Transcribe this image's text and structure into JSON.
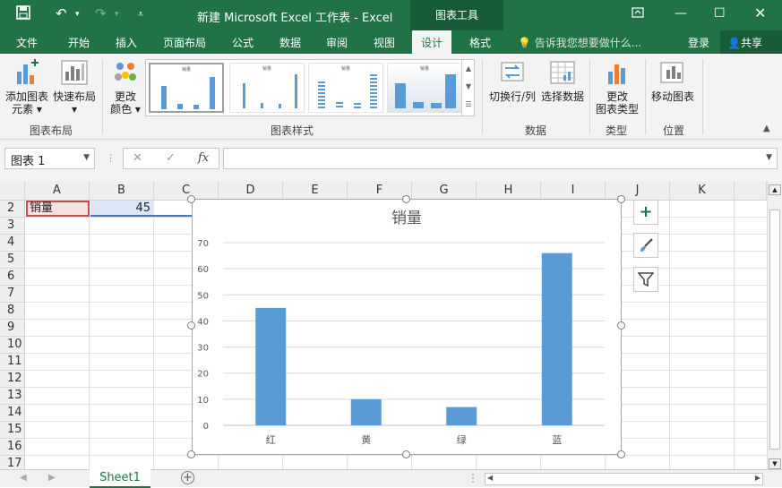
{
  "titlebar": {
    "save_icon": "save-icon",
    "undo_icon": "undo-icon",
    "redo_icon": "redo-icon",
    "customize_icon": "customize-icon",
    "title": "新建 Microsoft Excel 工作表 - Excel",
    "context_tab": "图表工具",
    "colors": {
      "brand": "#217346",
      "dark": "#185c37"
    }
  },
  "tabs": {
    "items": [
      "文件",
      "开始",
      "插入",
      "页面布局",
      "公式",
      "数据",
      "审阅",
      "视图",
      "设计",
      "格式"
    ],
    "active": "设计",
    "tell_me": "告诉我您想要做什么...",
    "login": "登录",
    "share": "共享"
  },
  "ribbon": {
    "add_element": "添加图表",
    "add_element_2": "元素",
    "quick_layout": "快速布局",
    "change_colors": "更改",
    "change_colors_2": "颜色",
    "group_layout": "图表布局",
    "group_styles": "图表样式",
    "switch_row_col": "切换行/列",
    "select_data": "选择数据",
    "group_data": "数据",
    "change_type": "更改",
    "change_type_2": "图表类型",
    "group_type": "类型",
    "move_chart": "移动图表",
    "group_location": "位置",
    "style_thumb_titles": [
      "销量",
      "销量",
      "销量",
      "销量"
    ]
  },
  "formula": {
    "name_box": "图表 1",
    "fx": "fx",
    "value": ""
  },
  "grid": {
    "columns": [
      "A",
      "B",
      "C",
      "D",
      "E",
      "F",
      "G",
      "H",
      "I",
      "J",
      "K"
    ],
    "rows": [
      "2",
      "3",
      "4",
      "5",
      "6",
      "7",
      "8",
      "9",
      "10",
      "11",
      "12",
      "13",
      "14",
      "15",
      "16",
      "17"
    ],
    "a2": "销量",
    "b2": "45"
  },
  "chart_data": {
    "type": "bar",
    "title": "销量",
    "categories": [
      "红",
      "黄",
      "绿",
      "蓝"
    ],
    "values": [
      45,
      10,
      7,
      66
    ],
    "ylim": [
      0,
      70
    ],
    "yticks": [
      "0",
      "10",
      "20",
      "30",
      "40",
      "50",
      "60",
      "70"
    ],
    "grid": true,
    "bar_color": "#5b9bd5"
  },
  "chart_side": {
    "add_icon": "plus-icon",
    "style_icon": "brush-icon",
    "filter_icon": "filter-icon"
  },
  "status": {
    "sheet": "Sheet1"
  }
}
